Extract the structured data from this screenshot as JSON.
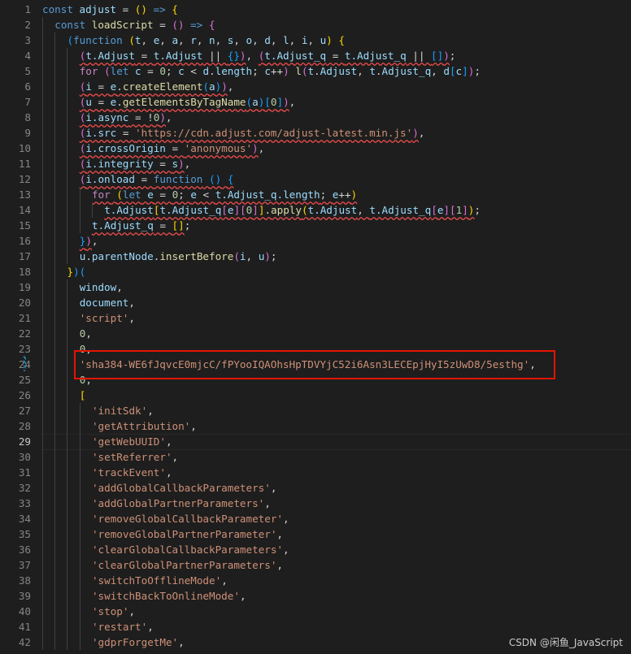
{
  "active_line": 29,
  "highlight_box_color": "#e51400",
  "watermark": "CSDN @闲鱼_JavaScript",
  "lines": [
    {
      "n": "1",
      "indent": 0,
      "tokens": [
        [
          "kw",
          "const"
        ],
        [
          "p",
          " "
        ],
        [
          "v",
          "adjust"
        ],
        [
          "p",
          " = "
        ],
        [
          "b1",
          "()"
        ],
        [
          "p",
          " "
        ],
        [
          "kw",
          "=>"
        ],
        [
          "p",
          " "
        ],
        [
          "b1",
          "{"
        ]
      ]
    },
    {
      "n": "2",
      "indent": 1,
      "tokens": [
        [
          "kw",
          "const"
        ],
        [
          "p",
          " "
        ],
        [
          "fn",
          "loadScript"
        ],
        [
          "p",
          " = "
        ],
        [
          "b2",
          "()"
        ],
        [
          "p",
          " "
        ],
        [
          "kw",
          "=>"
        ],
        [
          "p",
          " "
        ],
        [
          "b2",
          "{"
        ]
      ]
    },
    {
      "n": "3",
      "indent": 2,
      "tokens": [
        [
          "b3",
          "("
        ],
        [
          "kw",
          "function"
        ],
        [
          "p",
          " "
        ],
        [
          "b1",
          "("
        ],
        [
          "v",
          "t"
        ],
        [
          "p",
          ", "
        ],
        [
          "v",
          "e"
        ],
        [
          "p",
          ", "
        ],
        [
          "v",
          "a"
        ],
        [
          "p",
          ", "
        ],
        [
          "v",
          "r"
        ],
        [
          "p",
          ", "
        ],
        [
          "v",
          "n"
        ],
        [
          "p",
          ", "
        ],
        [
          "v",
          "s"
        ],
        [
          "p",
          ", "
        ],
        [
          "v",
          "o"
        ],
        [
          "p",
          ", "
        ],
        [
          "v",
          "d"
        ],
        [
          "p",
          ", "
        ],
        [
          "v",
          "l"
        ],
        [
          "p",
          ", "
        ],
        [
          "v",
          "i"
        ],
        [
          "p",
          ", "
        ],
        [
          "v",
          "u"
        ],
        [
          "b1",
          ")"
        ],
        [
          "p",
          " "
        ],
        [
          "b1",
          "{"
        ]
      ]
    },
    {
      "n": "4",
      "indent": 3,
      "tokens": [
        [
          "b2 sq",
          "("
        ],
        [
          "v sq",
          "t.Adjust"
        ],
        [
          "p sq",
          " = "
        ],
        [
          "v sq",
          "t.Adjust"
        ],
        [
          "p sq",
          " || "
        ],
        [
          "b3 sq",
          "{}"
        ],
        [
          "b2 sq",
          ")"
        ],
        [
          "p",
          ", "
        ],
        [
          "b2 sq",
          "("
        ],
        [
          "v sq",
          "t.Adjust_q"
        ],
        [
          "p sq",
          " = "
        ],
        [
          "v sq",
          "t.Adjust_q"
        ],
        [
          "p sq",
          " || "
        ],
        [
          "b3 sq",
          "[]"
        ],
        [
          "b2 sq",
          ")"
        ],
        [
          "p",
          ";"
        ]
      ]
    },
    {
      "n": "5",
      "indent": 3,
      "tokens": [
        [
          "ctl",
          "for"
        ],
        [
          "p",
          " "
        ],
        [
          "b2",
          "("
        ],
        [
          "kw",
          "let"
        ],
        [
          "p",
          " "
        ],
        [
          "v",
          "c"
        ],
        [
          "p",
          " = "
        ],
        [
          "n",
          "0"
        ],
        [
          "p",
          "; "
        ],
        [
          "v",
          "c"
        ],
        [
          "p",
          " < "
        ],
        [
          "v",
          "d"
        ],
        [
          "p",
          "."
        ],
        [
          "v",
          "length"
        ],
        [
          "p",
          "; "
        ],
        [
          "v",
          "c"
        ],
        [
          "p",
          "++"
        ],
        [
          "b2",
          ")"
        ],
        [
          "p",
          " "
        ],
        [
          "fn",
          "l"
        ],
        [
          "b2",
          "("
        ],
        [
          "v",
          "t"
        ],
        [
          "p",
          "."
        ],
        [
          "v",
          "Adjust"
        ],
        [
          "p",
          ", "
        ],
        [
          "v",
          "t"
        ],
        [
          "p",
          "."
        ],
        [
          "v",
          "Adjust_q"
        ],
        [
          "p",
          ", "
        ],
        [
          "v",
          "d"
        ],
        [
          "b3",
          "["
        ],
        [
          "v",
          "c"
        ],
        [
          "b3",
          "]"
        ],
        [
          "b2",
          ")"
        ],
        [
          "p",
          ";"
        ]
      ]
    },
    {
      "n": "6",
      "indent": 3,
      "tokens": [
        [
          "b2 sq",
          "("
        ],
        [
          "v sq",
          "i"
        ],
        [
          "p sq",
          " = "
        ],
        [
          "v sq",
          "e"
        ],
        [
          "p sq",
          "."
        ],
        [
          "fn sq",
          "createElement"
        ],
        [
          "b3 sq",
          "("
        ],
        [
          "v sq",
          "a"
        ],
        [
          "b3 sq",
          ")"
        ],
        [
          "b2 sq",
          ")"
        ],
        [
          "p",
          ","
        ]
      ]
    },
    {
      "n": "7",
      "indent": 3,
      "tokens": [
        [
          "b2 sq",
          "("
        ],
        [
          "v sq",
          "u"
        ],
        [
          "p sq",
          " = "
        ],
        [
          "v sq",
          "e"
        ],
        [
          "p sq",
          "."
        ],
        [
          "fn sq",
          "getElementsByTagName"
        ],
        [
          "b3 sq",
          "("
        ],
        [
          "v sq",
          "a"
        ],
        [
          "b3 sq",
          ")"
        ],
        [
          "b3 sq",
          "["
        ],
        [
          "n sq",
          "0"
        ],
        [
          "b3 sq",
          "]"
        ],
        [
          "b2 sq",
          ")"
        ],
        [
          "p",
          ","
        ]
      ]
    },
    {
      "n": "8",
      "indent": 3,
      "tokens": [
        [
          "b2 sq",
          "("
        ],
        [
          "v sq",
          "i.async"
        ],
        [
          "p sq",
          " = "
        ],
        [
          "p sq",
          "!"
        ],
        [
          "n sq",
          "0"
        ],
        [
          "b2 sq",
          ")"
        ],
        [
          "p",
          ","
        ]
      ]
    },
    {
      "n": "9",
      "indent": 3,
      "tokens": [
        [
          "b2 sq",
          "("
        ],
        [
          "v sq",
          "i.src"
        ],
        [
          "p sq",
          " = "
        ],
        [
          "s sq",
          "'https://cdn.adjust.com/adjust-latest.min.js'"
        ],
        [
          "b2 sq",
          ")"
        ],
        [
          "p",
          ","
        ]
      ]
    },
    {
      "n": "10",
      "indent": 3,
      "tokens": [
        [
          "b2 sq",
          "("
        ],
        [
          "v sq",
          "i.crossOrigin"
        ],
        [
          "p sq",
          " = "
        ],
        [
          "s sq",
          "'anonymous'"
        ],
        [
          "b2 sq",
          ")"
        ],
        [
          "p",
          ","
        ]
      ]
    },
    {
      "n": "11",
      "indent": 3,
      "tokens": [
        [
          "b2 sq",
          "("
        ],
        [
          "v sq",
          "i.integrity"
        ],
        [
          "p sq",
          " = "
        ],
        [
          "v sq",
          "s"
        ],
        [
          "b2 sq",
          ")"
        ],
        [
          "p",
          ","
        ]
      ]
    },
    {
      "n": "12",
      "indent": 3,
      "tokens": [
        [
          "b2 sq",
          "("
        ],
        [
          "v sq",
          "i.onload"
        ],
        [
          "p sq",
          " = "
        ],
        [
          "kw sq",
          "function"
        ],
        [
          "p sq",
          " "
        ],
        [
          "b3 sq",
          "()"
        ],
        [
          "p sq",
          " "
        ],
        [
          "b3 sq",
          "{"
        ]
      ]
    },
    {
      "n": "13",
      "indent": 4,
      "tokens": [
        [
          "ctl sq",
          "for"
        ],
        [
          "p sq",
          " "
        ],
        [
          "b1 sq",
          "("
        ],
        [
          "kw sq",
          "let"
        ],
        [
          "p sq",
          " "
        ],
        [
          "v sq",
          "e"
        ],
        [
          "p sq",
          " = "
        ],
        [
          "n sq",
          "0"
        ],
        [
          "p sq",
          "; "
        ],
        [
          "v sq",
          "e"
        ],
        [
          "p sq",
          " < "
        ],
        [
          "v sq",
          "t.Adjust_q.length"
        ],
        [
          "p sq",
          "; "
        ],
        [
          "v sq",
          "e"
        ],
        [
          "p sq",
          "++"
        ],
        [
          "b1 sq",
          ")"
        ]
      ]
    },
    {
      "n": "14",
      "indent": 5,
      "tokens": [
        [
          "v sq",
          "t.Adjust"
        ],
        [
          "b1 sq",
          "["
        ],
        [
          "v sq",
          "t.Adjust_q"
        ],
        [
          "b2 sq",
          "["
        ],
        [
          "v sq",
          "e"
        ],
        [
          "b2 sq",
          "]"
        ],
        [
          "b2 sq",
          "["
        ],
        [
          "n sq",
          "0"
        ],
        [
          "b2 sq",
          "]"
        ],
        [
          "b1 sq",
          "]"
        ],
        [
          "p sq",
          "."
        ],
        [
          "fn sq",
          "apply"
        ],
        [
          "b1 sq",
          "("
        ],
        [
          "v sq",
          "t.Adjust"
        ],
        [
          "p sq",
          ", "
        ],
        [
          "v sq",
          "t.Adjust_q"
        ],
        [
          "b2 sq",
          "["
        ],
        [
          "v sq",
          "e"
        ],
        [
          "b2 sq",
          "]"
        ],
        [
          "b2 sq",
          "["
        ],
        [
          "n sq",
          "1"
        ],
        [
          "b2 sq",
          "]"
        ],
        [
          "b1 sq",
          ")"
        ],
        [
          "p",
          ";"
        ]
      ]
    },
    {
      "n": "15",
      "indent": 4,
      "tokens": [
        [
          "v sq",
          "t.Adjust_q"
        ],
        [
          "p sq",
          " = "
        ],
        [
          "b1 sq",
          "[]"
        ],
        [
          "p",
          ";"
        ]
      ]
    },
    {
      "n": "16",
      "indent": 3,
      "tokens": [
        [
          "b3 sq",
          "}"
        ],
        [
          "b2 sq",
          ")"
        ],
        [
          "p",
          ","
        ]
      ]
    },
    {
      "n": "17",
      "indent": 3,
      "tokens": [
        [
          "v",
          "u"
        ],
        [
          "p",
          "."
        ],
        [
          "v",
          "parentNode"
        ],
        [
          "p",
          "."
        ],
        [
          "fn",
          "insertBefore"
        ],
        [
          "b2",
          "("
        ],
        [
          "v",
          "i"
        ],
        [
          "p",
          ", "
        ],
        [
          "v",
          "u"
        ],
        [
          "b2",
          ")"
        ],
        [
          "p",
          ";"
        ]
      ]
    },
    {
      "n": "18",
      "indent": 2,
      "tokens": [
        [
          "b1",
          "}"
        ],
        [
          "b3",
          ")"
        ],
        [
          "b3",
          "("
        ]
      ]
    },
    {
      "n": "19",
      "indent": 3,
      "tokens": [
        [
          "v",
          "window"
        ],
        [
          "p",
          ","
        ]
      ]
    },
    {
      "n": "20",
      "indent": 3,
      "tokens": [
        [
          "v",
          "document"
        ],
        [
          "p",
          ","
        ]
      ]
    },
    {
      "n": "21",
      "indent": 3,
      "tokens": [
        [
          "s",
          "'script'"
        ],
        [
          "p",
          ","
        ]
      ]
    },
    {
      "n": "22",
      "indent": 3,
      "tokens": [
        [
          "n",
          "0"
        ],
        [
          "p",
          ","
        ]
      ]
    },
    {
      "n": "23",
      "indent": 3,
      "tokens": [
        [
          "n",
          "0"
        ],
        [
          "p",
          ","
        ]
      ]
    },
    {
      "n": "24",
      "indent": 3,
      "tokens": [
        [
          "s",
          "'sha384-WE6fJqvcE0mjcC/fPYooIQAOhsHpTDVYjC52i6Asn3LECEpjHyI5zUwD8/5esthg'"
        ],
        [
          "p",
          ","
        ]
      ]
    },
    {
      "n": "25",
      "indent": 3,
      "tokens": [
        [
          "n",
          "0"
        ],
        [
          "p",
          ","
        ]
      ]
    },
    {
      "n": "26",
      "indent": 3,
      "tokens": [
        [
          "b1",
          "["
        ]
      ]
    },
    {
      "n": "27",
      "indent": 4,
      "tokens": [
        [
          "s",
          "'initSdk'"
        ],
        [
          "p",
          ","
        ]
      ]
    },
    {
      "n": "28",
      "indent": 4,
      "tokens": [
        [
          "s",
          "'getAttribution'"
        ],
        [
          "p",
          ","
        ]
      ]
    },
    {
      "n": "29",
      "indent": 4,
      "tokens": [
        [
          "s",
          "'getWebUUID'"
        ],
        [
          "p",
          ","
        ]
      ]
    },
    {
      "n": "30",
      "indent": 4,
      "tokens": [
        [
          "s",
          "'setReferrer'"
        ],
        [
          "p",
          ","
        ]
      ]
    },
    {
      "n": "31",
      "indent": 4,
      "tokens": [
        [
          "s",
          "'trackEvent'"
        ],
        [
          "p",
          ","
        ]
      ]
    },
    {
      "n": "32",
      "indent": 4,
      "tokens": [
        [
          "s",
          "'addGlobalCallbackParameters'"
        ],
        [
          "p",
          ","
        ]
      ]
    },
    {
      "n": "33",
      "indent": 4,
      "tokens": [
        [
          "s",
          "'addGlobalPartnerParameters'"
        ],
        [
          "p",
          ","
        ]
      ]
    },
    {
      "n": "34",
      "indent": 4,
      "tokens": [
        [
          "s",
          "'removeGlobalCallbackParameter'"
        ],
        [
          "p",
          ","
        ]
      ]
    },
    {
      "n": "35",
      "indent": 4,
      "tokens": [
        [
          "s",
          "'removeGlobalPartnerParameter'"
        ],
        [
          "p",
          ","
        ]
      ]
    },
    {
      "n": "36",
      "indent": 4,
      "tokens": [
        [
          "s",
          "'clearGlobalCallbackParameters'"
        ],
        [
          "p",
          ","
        ]
      ]
    },
    {
      "n": "37",
      "indent": 4,
      "tokens": [
        [
          "s",
          "'clearGlobalPartnerParameters'"
        ],
        [
          "p",
          ","
        ]
      ]
    },
    {
      "n": "38",
      "indent": 4,
      "tokens": [
        [
          "s",
          "'switchToOfflineMode'"
        ],
        [
          "p",
          ","
        ]
      ]
    },
    {
      "n": "39",
      "indent": 4,
      "tokens": [
        [
          "s",
          "'switchBackToOnlineMode'"
        ],
        [
          "p",
          ","
        ]
      ]
    },
    {
      "n": "40",
      "indent": 4,
      "tokens": [
        [
          "s",
          "'stop'"
        ],
        [
          "p",
          ","
        ]
      ]
    },
    {
      "n": "41",
      "indent": 4,
      "tokens": [
        [
          "s",
          "'restart'"
        ],
        [
          "p",
          ","
        ]
      ]
    },
    {
      "n": "42",
      "indent": 4,
      "tokens": [
        [
          "s",
          "'gdprForgetMe'"
        ],
        [
          "p",
          ","
        ]
      ]
    }
  ]
}
